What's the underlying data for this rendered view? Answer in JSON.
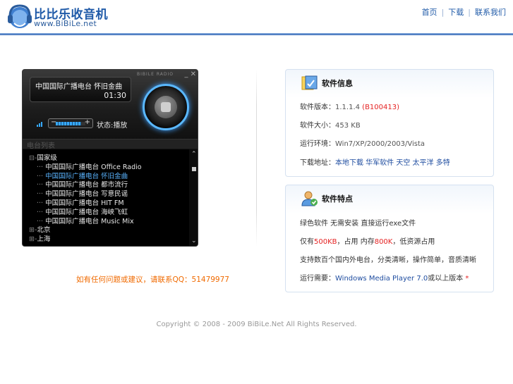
{
  "header": {
    "logo_title": "比比乐收音机",
    "logo_sub": "www.BiBiLe.net",
    "nav": [
      "首页",
      "下载",
      "联系我们"
    ]
  },
  "player": {
    "brand": "BIBILE RADIO",
    "window_controls": "_  ✕",
    "now_playing": "中国国际广播电台 怀旧金曲",
    "time": "01:30",
    "volume_minus": "−",
    "volume_plus": "+",
    "volume_level": 0.85,
    "status": "状态:播放",
    "list_header": "电台列表",
    "tree": [
      {
        "prefix": "⊟-",
        "label": "国家级",
        "selected": false
      },
      {
        "prefix": "··· ",
        "label": "中国国际广播电台 Office Radio",
        "selected": false
      },
      {
        "prefix": "··· ",
        "label": "中国国际广播电台 怀旧金曲",
        "selected": true
      },
      {
        "prefix": "··· ",
        "label": "中国国际广播电台 都市流行",
        "selected": false
      },
      {
        "prefix": "··· ",
        "label": "中国国际广播电台 写意民谣",
        "selected": false
      },
      {
        "prefix": "··· ",
        "label": "中国国际广播电台 HIT FM",
        "selected": false
      },
      {
        "prefix": "··· ",
        "label": "中国国际广播电台 海峡飞虹",
        "selected": false
      },
      {
        "prefix": "··· ",
        "label": "中国国际广播电台 Music Mix",
        "selected": false
      },
      {
        "prefix": "⊞-",
        "label": "北京",
        "selected": false
      },
      {
        "prefix": "⊞-",
        "label": "上海",
        "selected": false
      }
    ]
  },
  "contact": "如有任何问题或建议，请联系QQ：51479977",
  "software": {
    "title": "软件信息",
    "version_label": "软件版本：",
    "version": "1.1.1.4 ",
    "build": "(B100413)",
    "size_label": "软件大小：",
    "size": "453 KB",
    "os_label": "运行环境：",
    "os": "Win7/XP/2000/2003/Vista",
    "download_label": "下载地址：",
    "download_links": "本地下载 华军软件 天空 太平洋 多特"
  },
  "features": {
    "title": "软件特点",
    "line1": "绿色软件 无需安装 直接运行exe文件",
    "line2_pre": "仅有",
    "line2_a": "500KB",
    "line2_mid": "，占用 内存",
    "line2_b": "800K",
    "line2_post": "，低资源占用",
    "line3": "支持数百个国内外电台，分类清晰，操作简单，音质清晰",
    "line4_pre": "运行需要：",
    "line4_link": "Windows Media Player 7.0",
    "line4_post": "或以上版本 ",
    "line4_star": "*"
  },
  "footer": "Copyright © 2008 - 2009 BiBiLe.Net All Rights Reserved.",
  "colors": {
    "brand_blue": "#1f5aa8",
    "accent_red": "#e52222",
    "contact_orange": "#f06a00",
    "player_glow": "#5ab8ff"
  }
}
